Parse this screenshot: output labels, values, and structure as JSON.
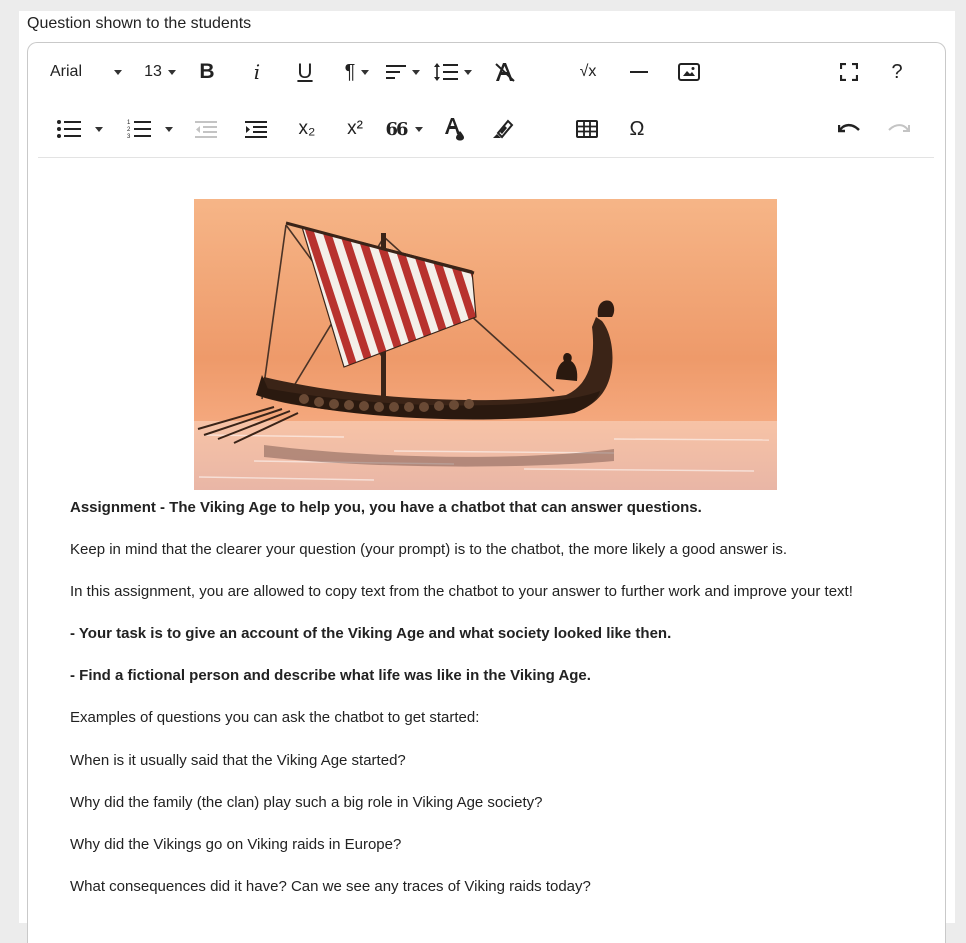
{
  "field_label": "Question shown to the students",
  "toolbar": {
    "font_family": "Arial",
    "font_size": "13",
    "bold_glyph": "B",
    "italic_glyph": "i",
    "underline_glyph": "U",
    "paragraph_glyph": "¶",
    "sqrt_glyph": "√x",
    "subscript_glyph": "x₂",
    "superscript_glyph": "x²",
    "quote_glyph": "66",
    "special_char_glyph": "Ω",
    "help_glyph": "?"
  },
  "content": {
    "paragraphs": [
      {
        "text": "Assignment - The Viking Age to help you, you have a chatbot that can answer questions.",
        "bold": true
      },
      {
        "text": "Keep in mind that the clearer your question (your prompt) is to the chatbot, the more likely a good answer is.",
        "bold": false
      },
      {
        "text": " In this assignment, you are allowed to copy text from the chatbot to your answer to further work and improve your text!",
        "bold": false
      },
      {
        "text": "- Your task is to give an account of the Viking Age and what society looked like then.",
        "bold": true
      },
      {
        "text": "- Find a fictional person and describe what life was like in the Viking Age.",
        "bold": true
      },
      {
        "text": "Examples of questions you can ask the chatbot to get started:",
        "bold": false
      },
      {
        "text": "When is it usually said that the Viking Age started?",
        "bold": false
      },
      {
        "text": "Why did the family (the clan) play such a big role in Viking Age society?",
        "bold": false
      },
      {
        "text": "Why did the Vikings go on Viking raids in Europe?",
        "bold": false
      },
      {
        "text": "What consequences did it have? Can we see any traces of Viking raids today?",
        "bold": false
      }
    ]
  },
  "colors": {
    "sky_top": "#f3a874",
    "sky_bottom": "#e88a5c",
    "sail_red": "#b5302f",
    "hull": "#3a2418"
  }
}
